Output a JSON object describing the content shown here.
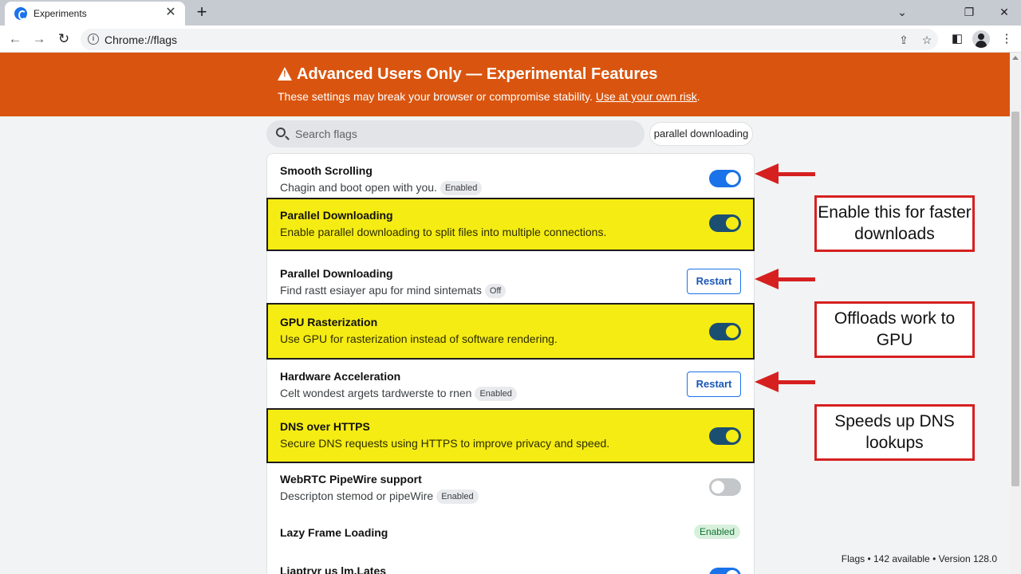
{
  "browser": {
    "tab_title": "Experiments",
    "tab_close": "✕",
    "new_tab": "+",
    "address": "Chrome://flags",
    "window_controls": [
      "⌄",
      "❐",
      "✕"
    ]
  },
  "banner": {
    "title": "Advanced Users Only — Experimental Features",
    "subtitle": "These settings may break your browser or compromise stability.",
    "link": "Use at your own risk",
    "link_suffix": ".",
    "color": "#d9550f"
  },
  "search": {
    "placeholder": "Search flags",
    "chip": "parallel downloading"
  },
  "flags": [
    {
      "title": "Smooth Scrolling",
      "desc": "Chagin and boot open with you.",
      "badge": "Enabled",
      "control": "toggle-on"
    },
    {
      "title": "Parallel Downloading",
      "desc": "Enable parallel downloading to split files into multiple connections.",
      "control": "toggle-on",
      "highlighted": true
    },
    {
      "title": "Parallel Downloading",
      "desc": "Find rastt esiayer apu for mind sintemats",
      "badge": "Off",
      "control": "restart",
      "button": "Restart"
    },
    {
      "title": "GPU Rasterization",
      "desc": "Use GPU for rasterization instead of software rendering.",
      "control": "toggle-on",
      "highlighted": true
    },
    {
      "title": "Hardware Acceleration",
      "desc": "Celt wondest argets tardwerste to rnen",
      "badge": "Enabled",
      "control": "restart",
      "button": "Restart"
    },
    {
      "title": "DNS over HTTPS",
      "desc": "Secure DNS requests using HTTPS to improve privacy and speed.",
      "control": "toggle-on",
      "highlighted": true
    },
    {
      "title": "WebRTC PipeWire support",
      "desc": "Descripton stemod or pipeWire",
      "badge": "Enabled",
      "control": "toggle-off"
    },
    {
      "title": "Lazy Frame Loading",
      "badge": "Enabled",
      "control": "badge"
    },
    {
      "title": "Liaptryr us lm.Lates",
      "control": "toggle-on"
    }
  ],
  "callouts": [
    {
      "text": "Enable this for faster downloads"
    },
    {
      "text": "Offloads work to GPU"
    },
    {
      "text": "Speeds up DNS lookups"
    }
  ],
  "footer": "Flags • 142 available • Version 128.0",
  "colors": {
    "highlight": "#f5ec13",
    "callout_border": "#d62020",
    "toggle_on": "#1a73e8"
  }
}
